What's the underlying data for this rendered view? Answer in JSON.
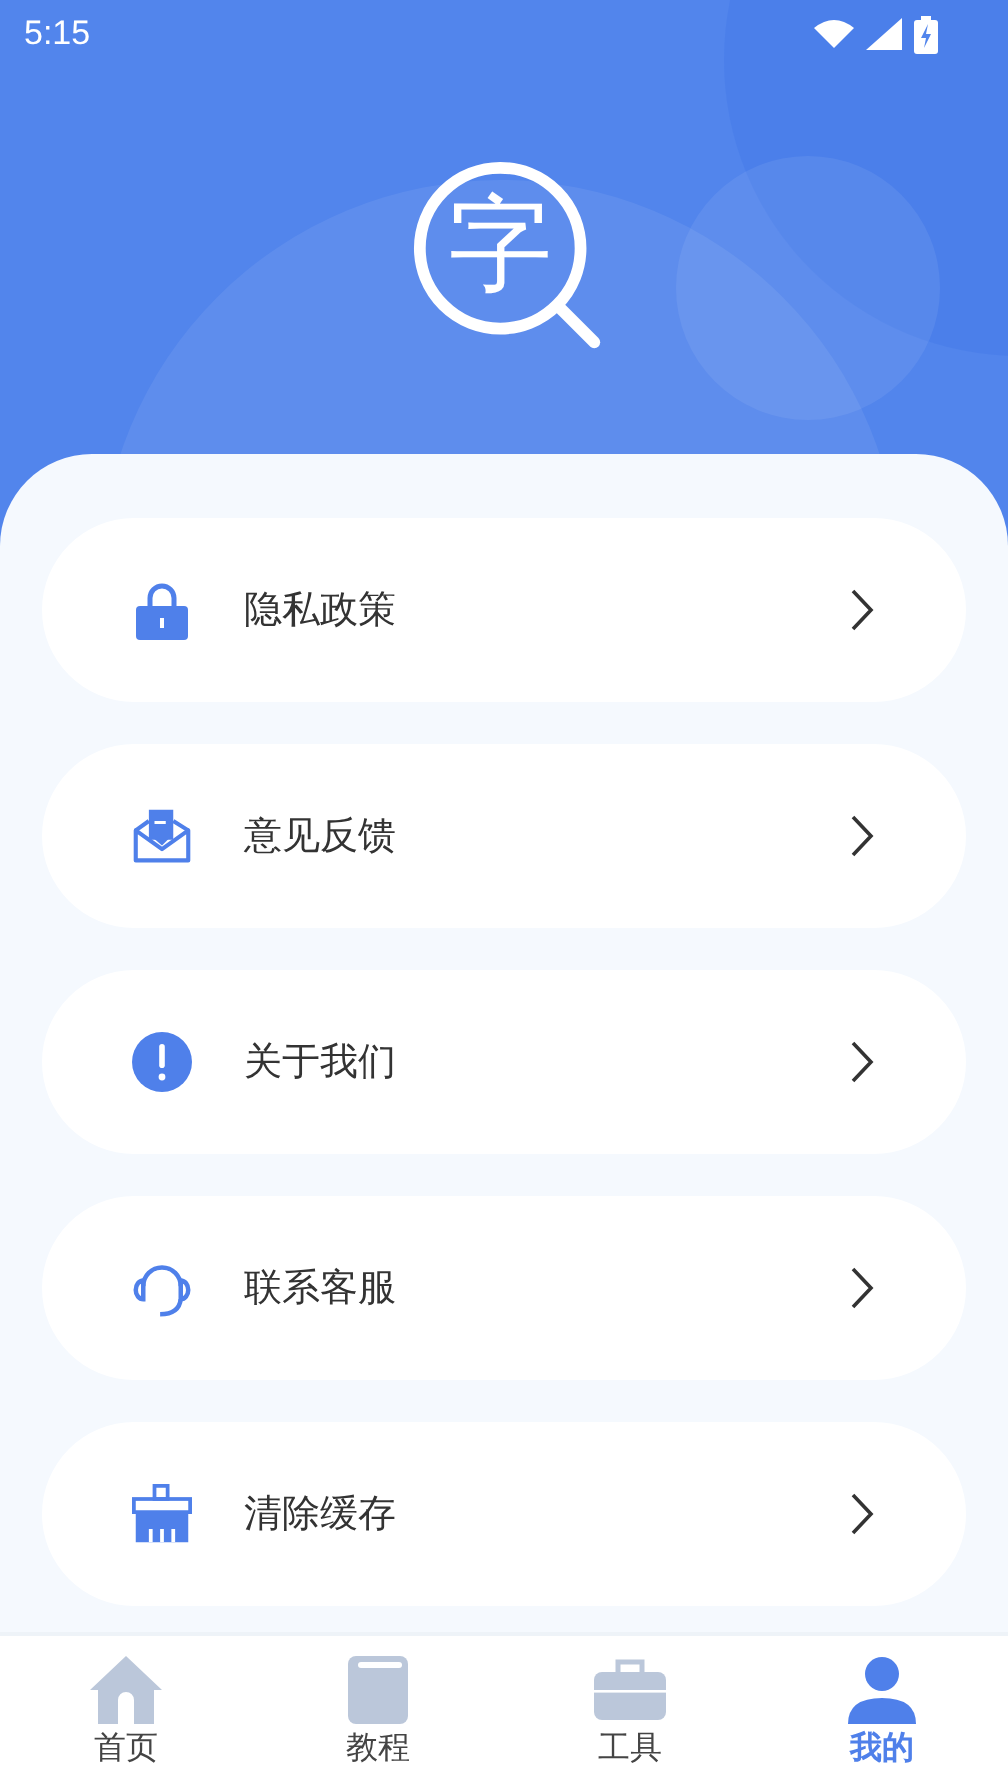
{
  "status_bar": {
    "time": "5:15"
  },
  "logo": {
    "glyph": "字"
  },
  "menu": [
    {
      "kind": "lock",
      "label": "隐私政策"
    },
    {
      "kind": "mail",
      "label": "意见反馈"
    },
    {
      "kind": "info",
      "label": "关于我们"
    },
    {
      "kind": "headset",
      "label": "联系客服"
    },
    {
      "kind": "broom",
      "label": "清除缓存"
    }
  ],
  "tabs": [
    {
      "kind": "home",
      "label": "首页",
      "selected": false
    },
    {
      "kind": "book",
      "label": "教程",
      "selected": false
    },
    {
      "kind": "toolbox",
      "label": "工具",
      "selected": false
    },
    {
      "kind": "person",
      "label": "我的",
      "selected": true
    }
  ]
}
